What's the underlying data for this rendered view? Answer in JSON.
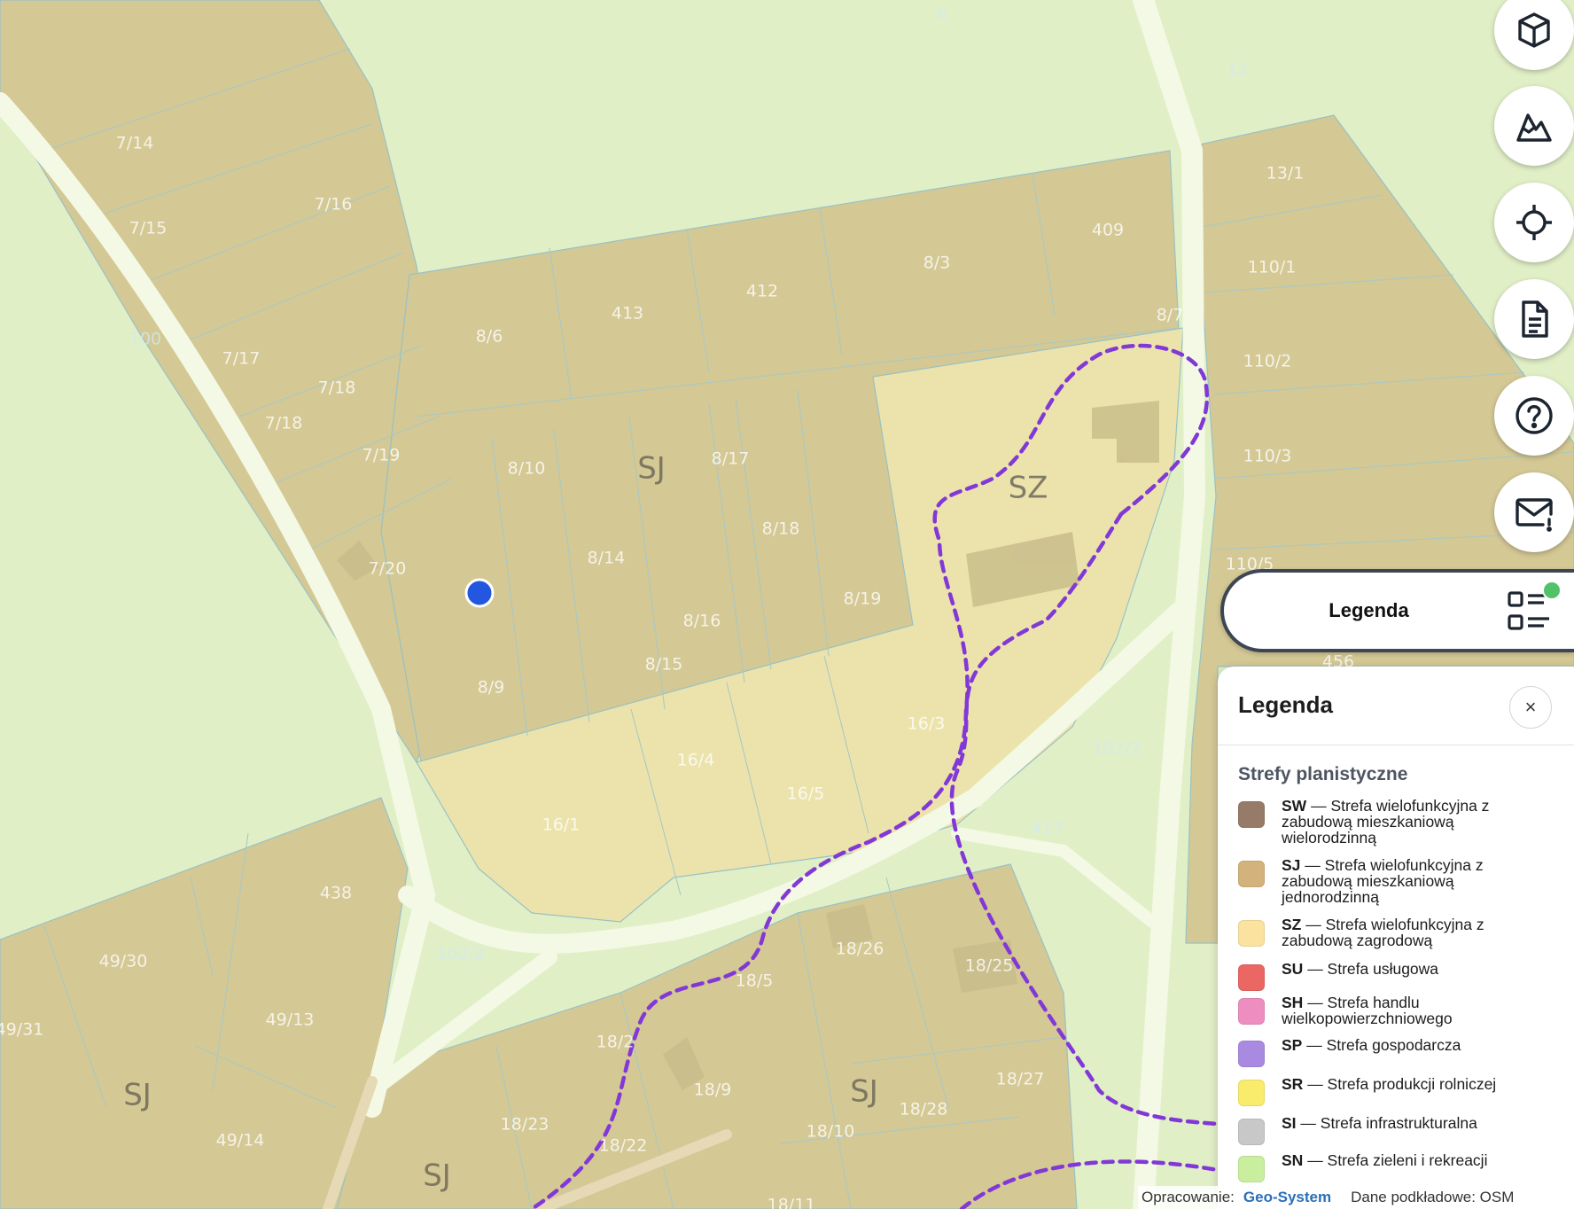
{
  "map": {
    "parcels": [
      "6",
      "12",
      "7/14",
      "7/15",
      "7/16",
      "100",
      "7/17",
      "7/18",
      "7/18",
      "7/19",
      "7/20",
      "8/6",
      "413",
      "412",
      "8/3",
      "409",
      "8/7",
      "13/1",
      "110/1",
      "110/2",
      "110/3",
      "110/5",
      "8/10",
      "8/17",
      "8/14",
      "8/18",
      "8/19",
      "8/16",
      "8/15",
      "8/9",
      "16/3",
      "102/2",
      "456",
      "16/4",
      "16/5",
      "16/1",
      "417",
      "438",
      "49/30",
      "102/2",
      "49/13",
      "49/31",
      "18/26",
      "18/25",
      "18/5",
      "18/2",
      "18/9",
      "18/27",
      "18/28",
      "18/23",
      "18/22",
      "18/10",
      "49/14",
      "18/11"
    ],
    "zones": [
      "SJ",
      "SZ",
      "SJ",
      "SJ",
      "SJ"
    ]
  },
  "controls": {
    "icons": [
      "cube-3d-icon",
      "terrain-icon",
      "locate-icon",
      "document-icon",
      "help-icon",
      "mail-alert-icon"
    ]
  },
  "legend_toggle": {
    "label": "Legenda",
    "icon": "legend-list-icon",
    "status": "active"
  },
  "legend": {
    "title": "Legenda",
    "close_symbol": "×",
    "section": "Strefy planistyczne",
    "items": [
      {
        "code": "SW",
        "desc": "— Strefa wielofunkcyjna z zabudową mieszkaniową wielorodzinną",
        "color": "#967b68"
      },
      {
        "code": "SJ",
        "desc": "— Strefa wielofunkcyjna z zabudową mieszkaniową jednorodzinną",
        "color": "#d4b27c"
      },
      {
        "code": "SZ",
        "desc": "— Strefa wielofunkcyjna z zabudową zagrodową",
        "color": "#fbe29e"
      },
      {
        "code": "SU",
        "desc": "— Strefa usługowa",
        "color": "#ea6763"
      },
      {
        "code": "SH",
        "desc": "— Strefa handlu wielkopowierzchniowego",
        "color": "#ee8ec0"
      },
      {
        "code": "SP",
        "desc": "— Strefa gospodarcza",
        "color": "#a98ae0"
      },
      {
        "code": "SR",
        "desc": "— Strefa produkcji rolniczej",
        "color": "#f9ec6c"
      },
      {
        "code": "SI",
        "desc": "— Strefa infrastrukturalna",
        "color": "#c8c8c8"
      },
      {
        "code": "SN",
        "desc": "— Strefa zieleni i rekreacji",
        "color": "#c9ef9e"
      }
    ]
  },
  "attribution": {
    "prefix": "Opracowanie:",
    "author": "Geo-System",
    "basemap": "Dane podkładowe: OSM"
  }
}
